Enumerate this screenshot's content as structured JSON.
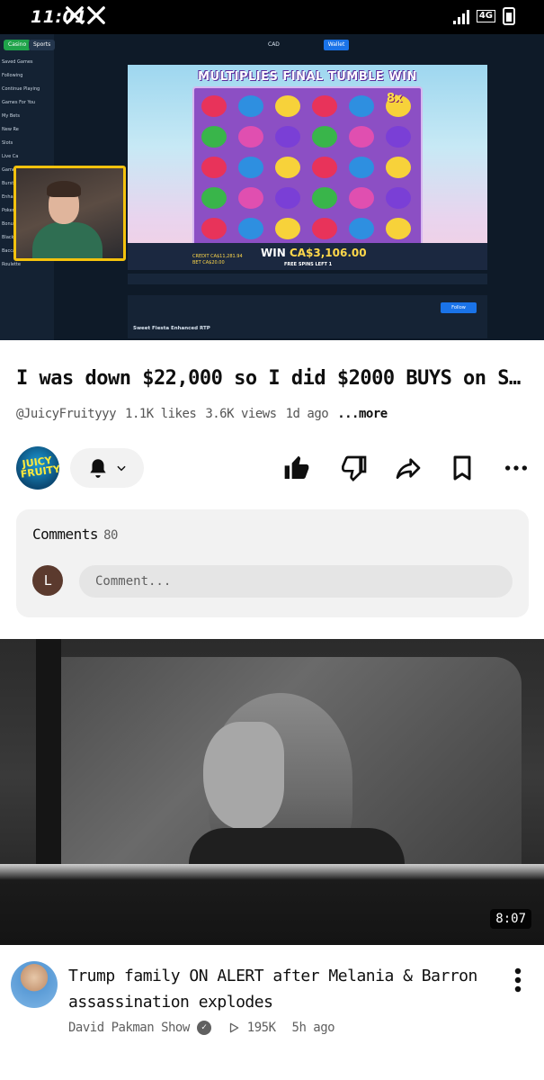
{
  "status_bar": {
    "time": "11:01",
    "network": "4G"
  },
  "video": {
    "stream": {
      "tabs": [
        "Casino",
        "Sports"
      ],
      "sidebar_items": [
        "Saved Games",
        "Following",
        "Continue Playing",
        "Games For You",
        "My Bets",
        "New Re",
        "Slots",
        "Live Ca",
        "Game",
        "Burst C",
        "Enhanc",
        "Poker",
        "Bonus Buy",
        "Blackjack",
        "Baccarat",
        "Roulette"
      ],
      "currency": "CAD",
      "wallet_label": "Wallet",
      "game_banner": "MULTIPLIES FINAL TUMBLE WIN",
      "multiplier": "8x",
      "credit": "CREDIT CA$11,281.94",
      "bet": "BET CA$20.00",
      "win_label": "WIN",
      "win_amount": "CA$3,106.00",
      "free_spins": "FREE SPINS LEFT 1",
      "follow_label": "Follow",
      "game_name": "Sweet Fiesta Enhanced RTP"
    },
    "progress": 0.46
  },
  "info": {
    "title": "I was down $22,000 so I did $2000 BUYS on S...",
    "channel_handle": "@JuicyFruityyy",
    "likes": "1.1K likes",
    "views": "3.6K views",
    "age": "1d ago",
    "more": "...more",
    "channel_avatar_text": "JUICY FRUITY"
  },
  "comments": {
    "label": "Comments",
    "count": "80",
    "user_initial": "L",
    "placeholder": "Comment..."
  },
  "next_video": {
    "duration": "8:07",
    "title": "Trump family ON ALERT after Melania & Barron assassination explodes",
    "channel": "David Pakman Show",
    "views": "195K",
    "age": "5h ago"
  },
  "colors": {
    "accent_red": "#ff0000",
    "stream_bg": "#0e1a28",
    "webcam_border": "#f4c20d",
    "panel_bg": "#f2f2f2"
  },
  "icons": [
    "x-logo-icon",
    "signal-icon",
    "battery-icon",
    "bell-icon",
    "chevron-down-icon",
    "like-icon",
    "dislike-icon",
    "share-icon",
    "save-icon",
    "more-icon",
    "verified-icon",
    "play-icon",
    "kebab-icon"
  ]
}
